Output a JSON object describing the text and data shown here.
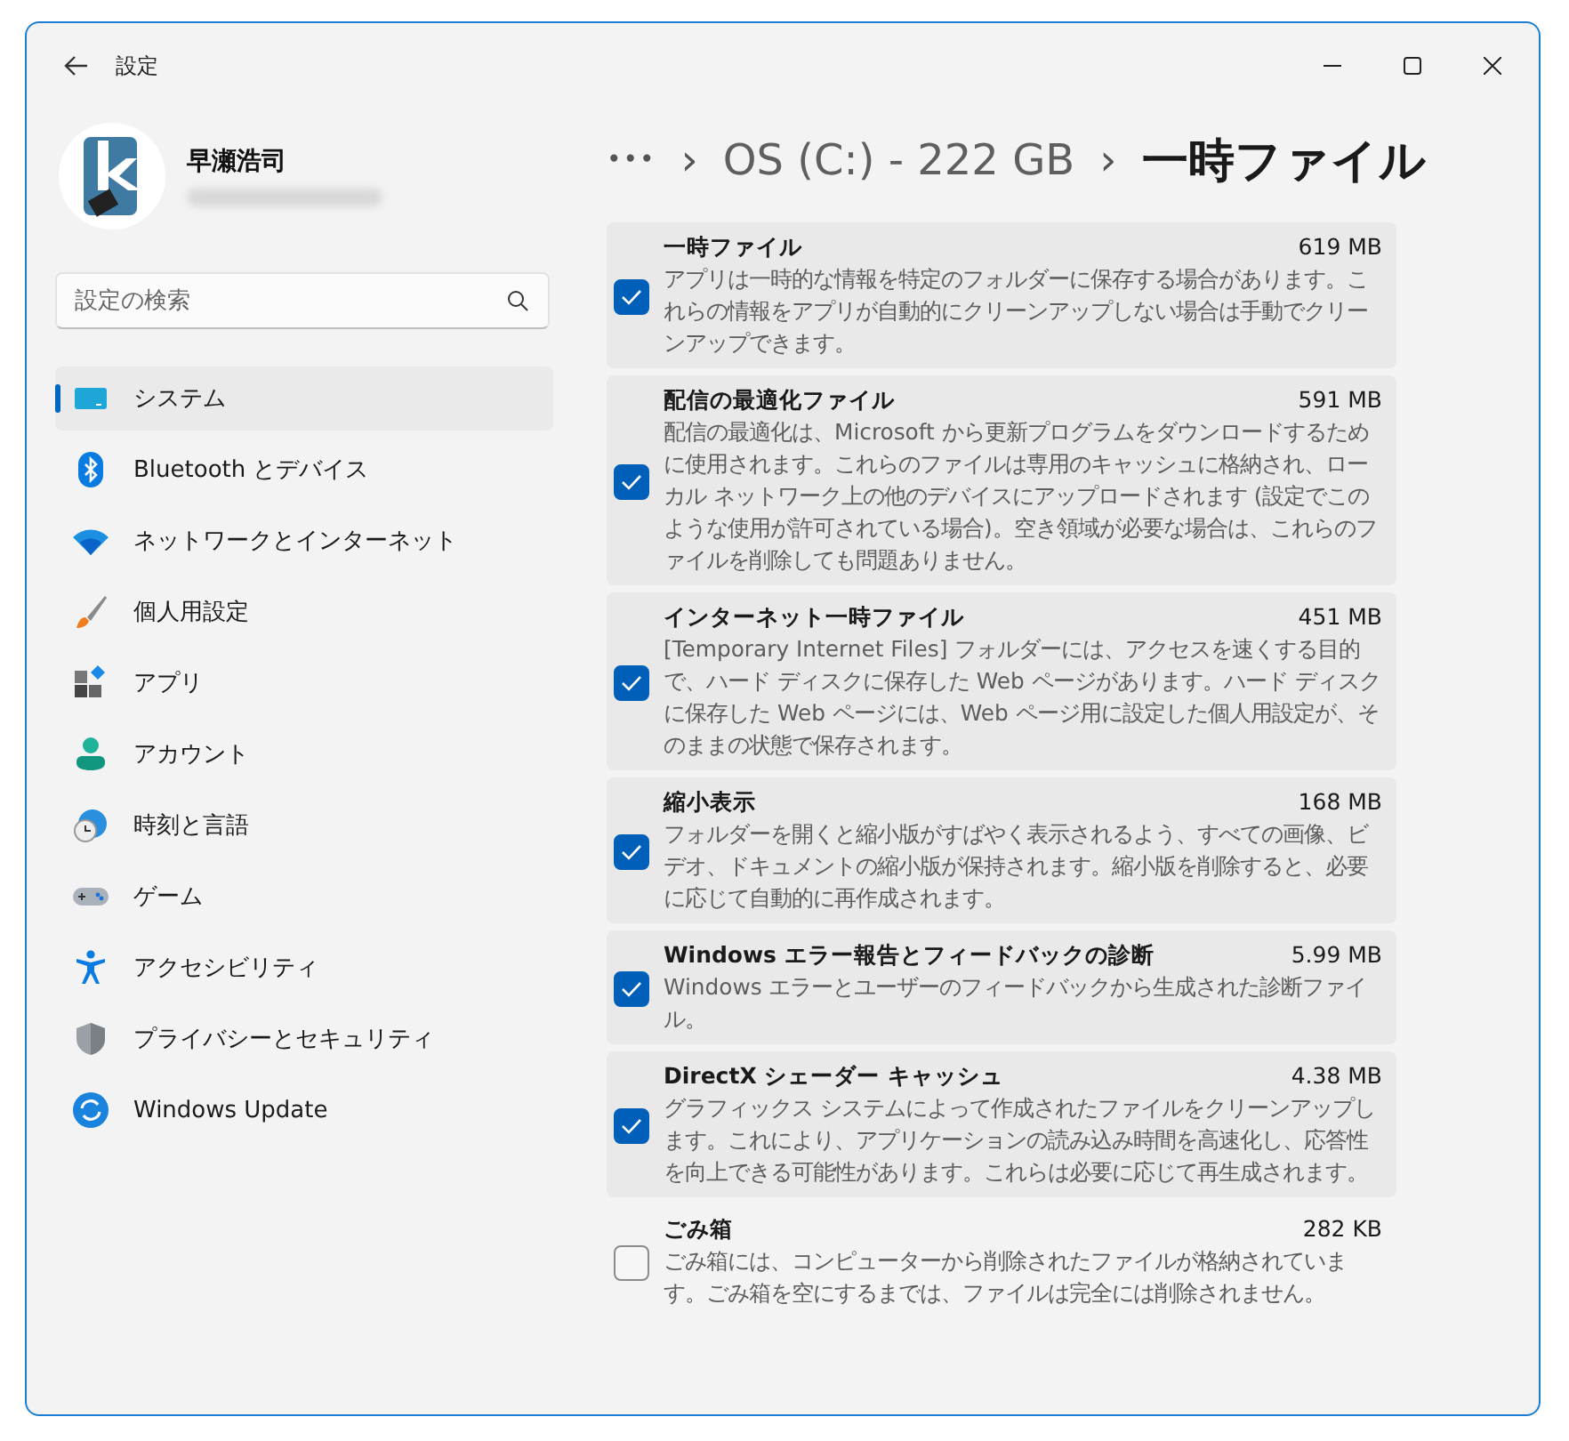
{
  "window": {
    "title": "設定"
  },
  "user": {
    "name": "早瀬浩司"
  },
  "search": {
    "placeholder": "設定の検索"
  },
  "sidebar": {
    "items": [
      {
        "label": "システム",
        "selected": true
      },
      {
        "label": "Bluetooth とデバイス",
        "selected": false
      },
      {
        "label": "ネットワークとインターネット",
        "selected": false
      },
      {
        "label": "個人用設定",
        "selected": false
      },
      {
        "label": "アプリ",
        "selected": false
      },
      {
        "label": "アカウント",
        "selected": false
      },
      {
        "label": "時刻と言語",
        "selected": false
      },
      {
        "label": "ゲーム",
        "selected": false
      },
      {
        "label": "アクセシビリティ",
        "selected": false
      },
      {
        "label": "プライバシーとセキュリティ",
        "selected": false
      },
      {
        "label": "Windows Update",
        "selected": false
      }
    ]
  },
  "breadcrumb": {
    "overflow": "•••",
    "separator": "›",
    "items": [
      "OS (C:) - 222 GB",
      "一時ファイル"
    ]
  },
  "files": [
    {
      "name": "一時ファイル",
      "size": "619 MB",
      "checked": true,
      "description": "アプリは一時的な情報を特定のフォルダーに保存する場合があります。これらの情報をアプリが自動的にクリーンアップしない場合は手動でクリーンアップできます。"
    },
    {
      "name": "配信の最適化ファイル",
      "size": "591 MB",
      "checked": true,
      "description": "配信の最適化は、Microsoft から更新プログラムをダウンロードするために使用されます。これらのファイルは専用のキャッシュに格納され、ローカル ネットワーク上の他のデバイスにアップロードされます (設定でこのような使用が許可されている場合)。空き領域が必要な場合は、これらのファイルを削除しても問題ありません。"
    },
    {
      "name": "インターネット一時ファイル",
      "size": "451 MB",
      "checked": true,
      "description": "[Temporary Internet Files] フォルダーには、アクセスを速くする目的で、ハード ディスクに保存した Web ページがあります。ハード ディスクに保存した Web ページには、Web ページ用に設定した個人用設定が、そのままの状態で保存されます。"
    },
    {
      "name": "縮小表示",
      "size": "168 MB",
      "checked": true,
      "description": "フォルダーを開くと縮小版がすばやく表示されるよう、すべての画像、ビデオ、ドキュメントの縮小版が保持されます。縮小版を削除すると、必要に応じて自動的に再作成されます。"
    },
    {
      "name": "Windows エラー報告とフィードバックの診断",
      "size": "5.99 MB",
      "checked": true,
      "description": "Windows エラーとユーザーのフィードバックから生成された診断ファイル。"
    },
    {
      "name": "DirectX シェーダー キャッシュ",
      "size": "4.38 MB",
      "checked": true,
      "description": "グラフィックス システムによって作成されたファイルをクリーンアップします。これにより、アプリケーションの読み込み時間を高速化し、応答性を向上できる可能性があります。これらは必要に応じて再生成されます。"
    },
    {
      "name": "ごみ箱",
      "size": "282 KB",
      "checked": false,
      "description": "ごみ箱には、コンピューターから削除されたファイルが格納されています。ごみ箱を空にするまでは、ファイルは完全には削除されません。"
    }
  ]
}
